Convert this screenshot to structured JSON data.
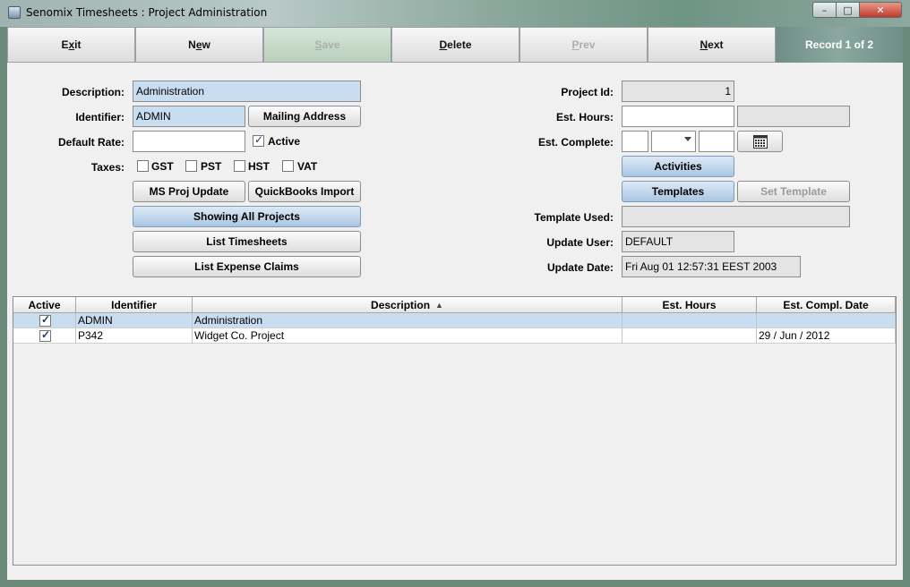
{
  "window": {
    "title": "Senomix Timesheets : Project Administration",
    "min": "–",
    "max": "□",
    "close": "✕"
  },
  "toolbar": {
    "exit": {
      "pre": "E",
      "u": "x",
      "post": "it"
    },
    "new": {
      "pre": "N",
      "u": "e",
      "post": "w"
    },
    "save": {
      "pre": "",
      "u": "S",
      "post": "ave"
    },
    "delete": {
      "pre": "",
      "u": "D",
      "post": "elete"
    },
    "prev": {
      "pre": "",
      "u": "P",
      "post": "rev"
    },
    "next": {
      "pre": "",
      "u": "N",
      "post": "ext"
    },
    "record": "Record 1 of 2"
  },
  "form": {
    "description_label": "Description:",
    "description_value": "Administration",
    "identifier_label": "Identifier:",
    "identifier_value": "ADMIN",
    "mailing_address": "Mailing Address",
    "default_rate_label": "Default Rate:",
    "default_rate_value": "",
    "active_label": "Active",
    "taxes_label": "Taxes:",
    "taxes": [
      "GST",
      "PST",
      "HST",
      "VAT"
    ],
    "ms_proj_update": "MS Proj Update",
    "quickbooks_import": "QuickBooks Import",
    "showing_all": "Showing All Projects",
    "list_timesheets": "List Timesheets",
    "list_expense_claims": "List Expense Claims",
    "project_id_label": "Project Id:",
    "project_id_value": "1",
    "est_hours_label": "Est. Hours:",
    "est_hours_value": "",
    "est_complete_label": "Est. Complete:",
    "activities": "Activities",
    "templates": "Templates",
    "set_template": "Set Template",
    "template_used_label": "Template Used:",
    "template_used_value": "",
    "update_user_label": "Update User:",
    "update_user_value": "DEFAULT",
    "update_date_label": "Update Date:",
    "update_date_value": "Fri Aug 01 12:57:31 EEST 2003"
  },
  "table": {
    "columns": [
      "Active",
      "Identifier",
      "Description",
      "Est. Hours",
      "Est. Compl. Date"
    ],
    "rows": [
      {
        "active": true,
        "identifier": "ADMIN",
        "description": "Administration",
        "est_hours": "",
        "est_date": ""
      },
      {
        "active": true,
        "identifier": "P342",
        "description": "Widget Co. Project",
        "est_hours": "",
        "est_date": "29 / Jun / 2012"
      }
    ]
  }
}
